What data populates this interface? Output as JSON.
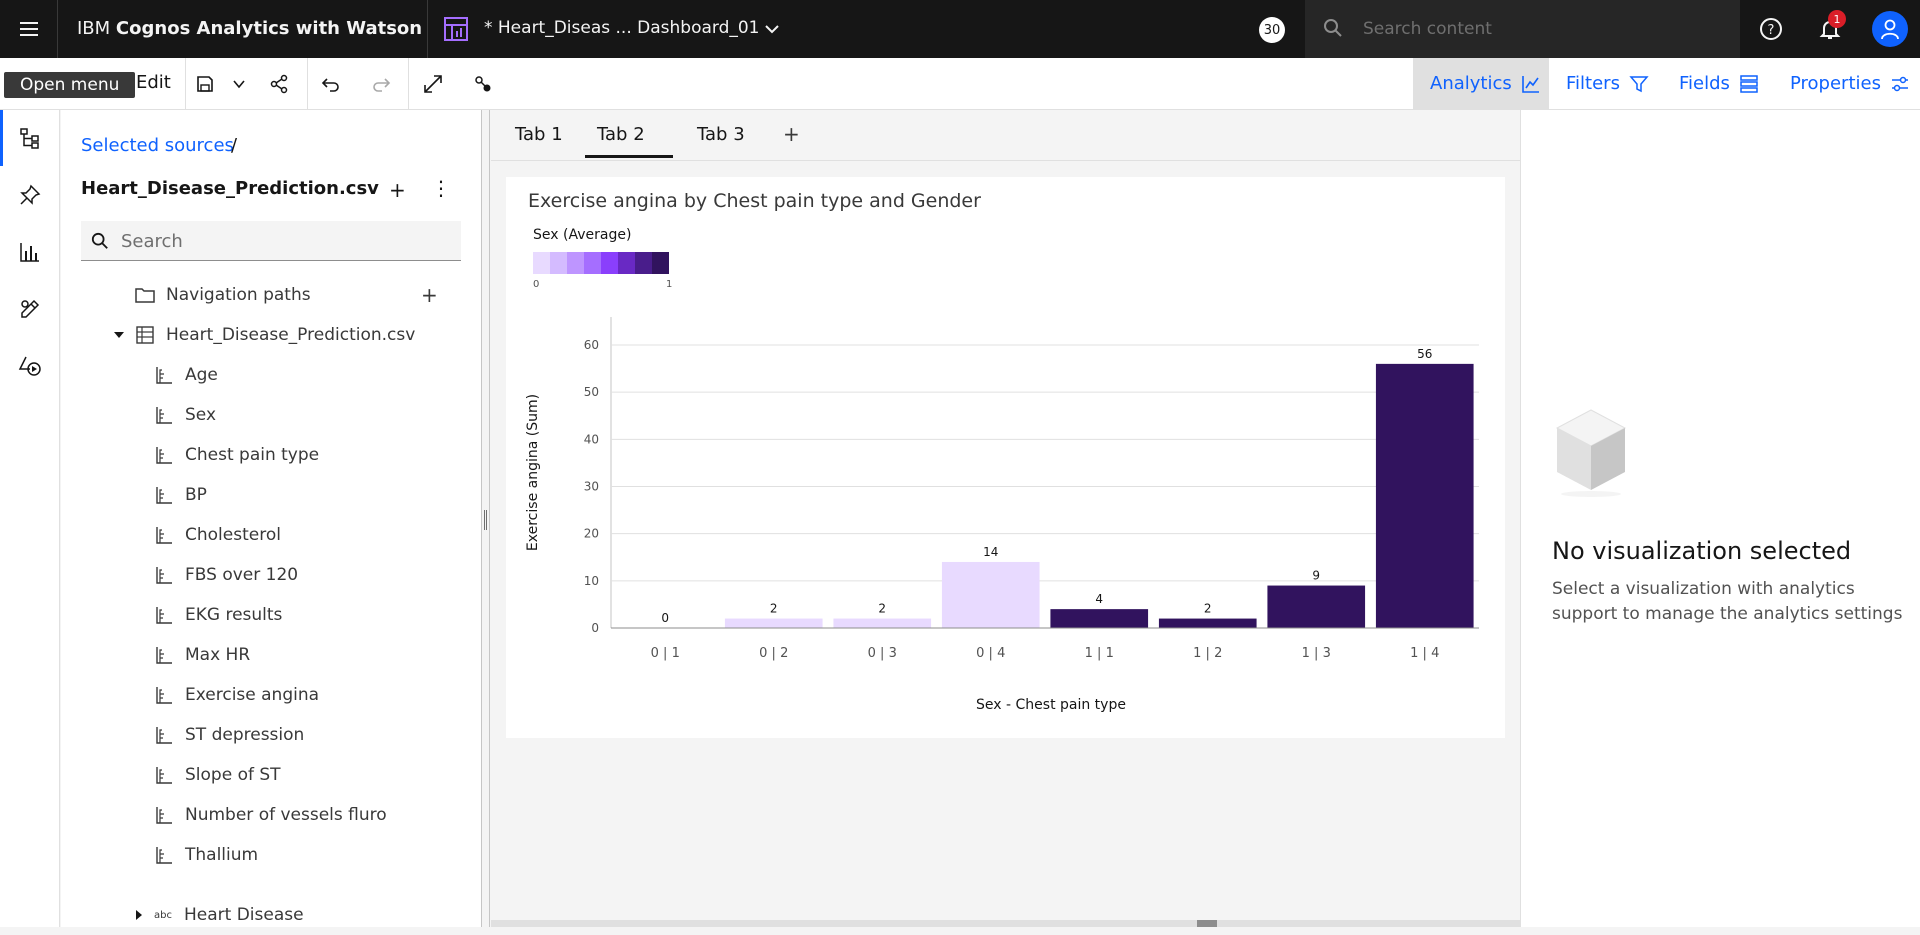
{
  "topbar": {
    "brand_prefix": "IBM ",
    "brand_bold": "Cognos Analytics with Watson",
    "dashboard_title": "* Heart_Diseas ... Dashboard_01",
    "badge_count": "30",
    "search_placeholder": "Search content",
    "notification_count": "1"
  },
  "toolbar": {
    "tooltip": "Open menu",
    "edit_label": "Edit",
    "analytics_label": "Analytics",
    "filters_label": "Filters",
    "fields_label": "Fields",
    "properties_label": "Properties"
  },
  "sidepanel": {
    "breadcrumb": "Selected sources",
    "breadcrumb_sep": "/",
    "source_title": "Heart_Disease_Prediction.csv",
    "search_placeholder": "Search",
    "navigation_paths": "Navigation paths",
    "table_name": "Heart_Disease_Prediction.csv",
    "fields": [
      "Age",
      "Sex",
      "Chest pain type",
      "BP",
      "Cholesterol",
      "FBS over 120",
      "EKG results",
      "Max HR",
      "Exercise angina",
      "ST depression",
      "Slope of ST",
      "Number of vessels fluro",
      "Thallium"
    ],
    "text_field": "Heart Disease",
    "text_field_icon": "abc"
  },
  "tabs": [
    "Tab 1",
    "Tab 2",
    "Tab 3"
  ],
  "active_tab": "Tab 2",
  "colors": {
    "accent": "#0f62fe",
    "bar_low": "#e8daff",
    "bar_high": "#31135e",
    "legend_scale": [
      "#e8daff",
      "#d4bbff",
      "#be95ff",
      "#a56eff",
      "#8a3ffc",
      "#6929c4",
      "#491d8b",
      "#31135e"
    ]
  },
  "chart_data": {
    "type": "bar",
    "title": "Exercise angina by Chest pain type and Gender",
    "legend_title": "Sex (Average)",
    "legend_min": "0",
    "legend_max": "1",
    "xlabel": "Sex - Chest pain type",
    "ylabel": "Exercise angina (Sum)",
    "categories": [
      "0 | 1",
      "0 | 2",
      "0 | 3",
      "0 | 4",
      "1 | 1",
      "1 | 2",
      "1 | 3",
      "1 | 4"
    ],
    "values": [
      0,
      2,
      2,
      14,
      4,
      2,
      9,
      56
    ],
    "color_values": [
      0,
      0,
      0,
      0,
      1,
      1,
      1,
      1
    ],
    "yticks": [
      0,
      10,
      20,
      30,
      40,
      50,
      60
    ],
    "ylim": [
      0,
      60
    ],
    "grid": true
  },
  "rightpanel": {
    "title": "No visualization selected",
    "description": "Select a visualization with analytics support to manage the analytics settings"
  }
}
